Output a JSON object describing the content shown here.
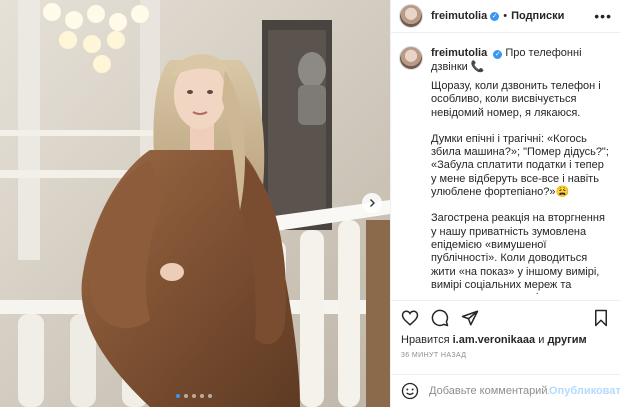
{
  "post": {
    "username": "freimutolia",
    "separator": "•",
    "follow_label": "Подписки",
    "more_glyph": "•••",
    "verified_glyph": "✓"
  },
  "caption": {
    "title": "Про телефонні дзвінки 📞",
    "paragraphs": [
      "Щоразу, коли дзвонить телефон і особливо, коли висвічується невідомий номер, я лякаюся.",
      "Думки епічні і трагічні: «Когось збила машина?»; \"Помер дідусь?\"; «Забула сплатити податки і тепер у мене відберуть все-все і навіть улюблене фортепіано?»😩",
      "Загострена реакція на вторгнення у нашу приватність зумовлена епідемією «вимушеної публічності». Коли доводиться жити «на показ» у іншому вимірі, вимірі соціальних мереж та завищених стандартів."
    ]
  },
  "likes": {
    "prefix": "Нравится",
    "user": "i.am.veronikaaa",
    "conjunction": "и",
    "others": "другим"
  },
  "timestamp": "36 МИНУТ НАЗАД",
  "comment": {
    "placeholder": "Добавьте комментарий...",
    "post_label": "Опубликовать"
  },
  "icons": [
    "heart-icon",
    "comment-icon",
    "share-icon",
    "bookmark-icon",
    "emoji-icon",
    "chevron-right-icon"
  ],
  "colors": {
    "accent": "#3897f0",
    "post_button_disabled": "#b3dbff",
    "dress": "#8a5a3a"
  },
  "carousel": {
    "count": 5,
    "active_index": 0
  }
}
